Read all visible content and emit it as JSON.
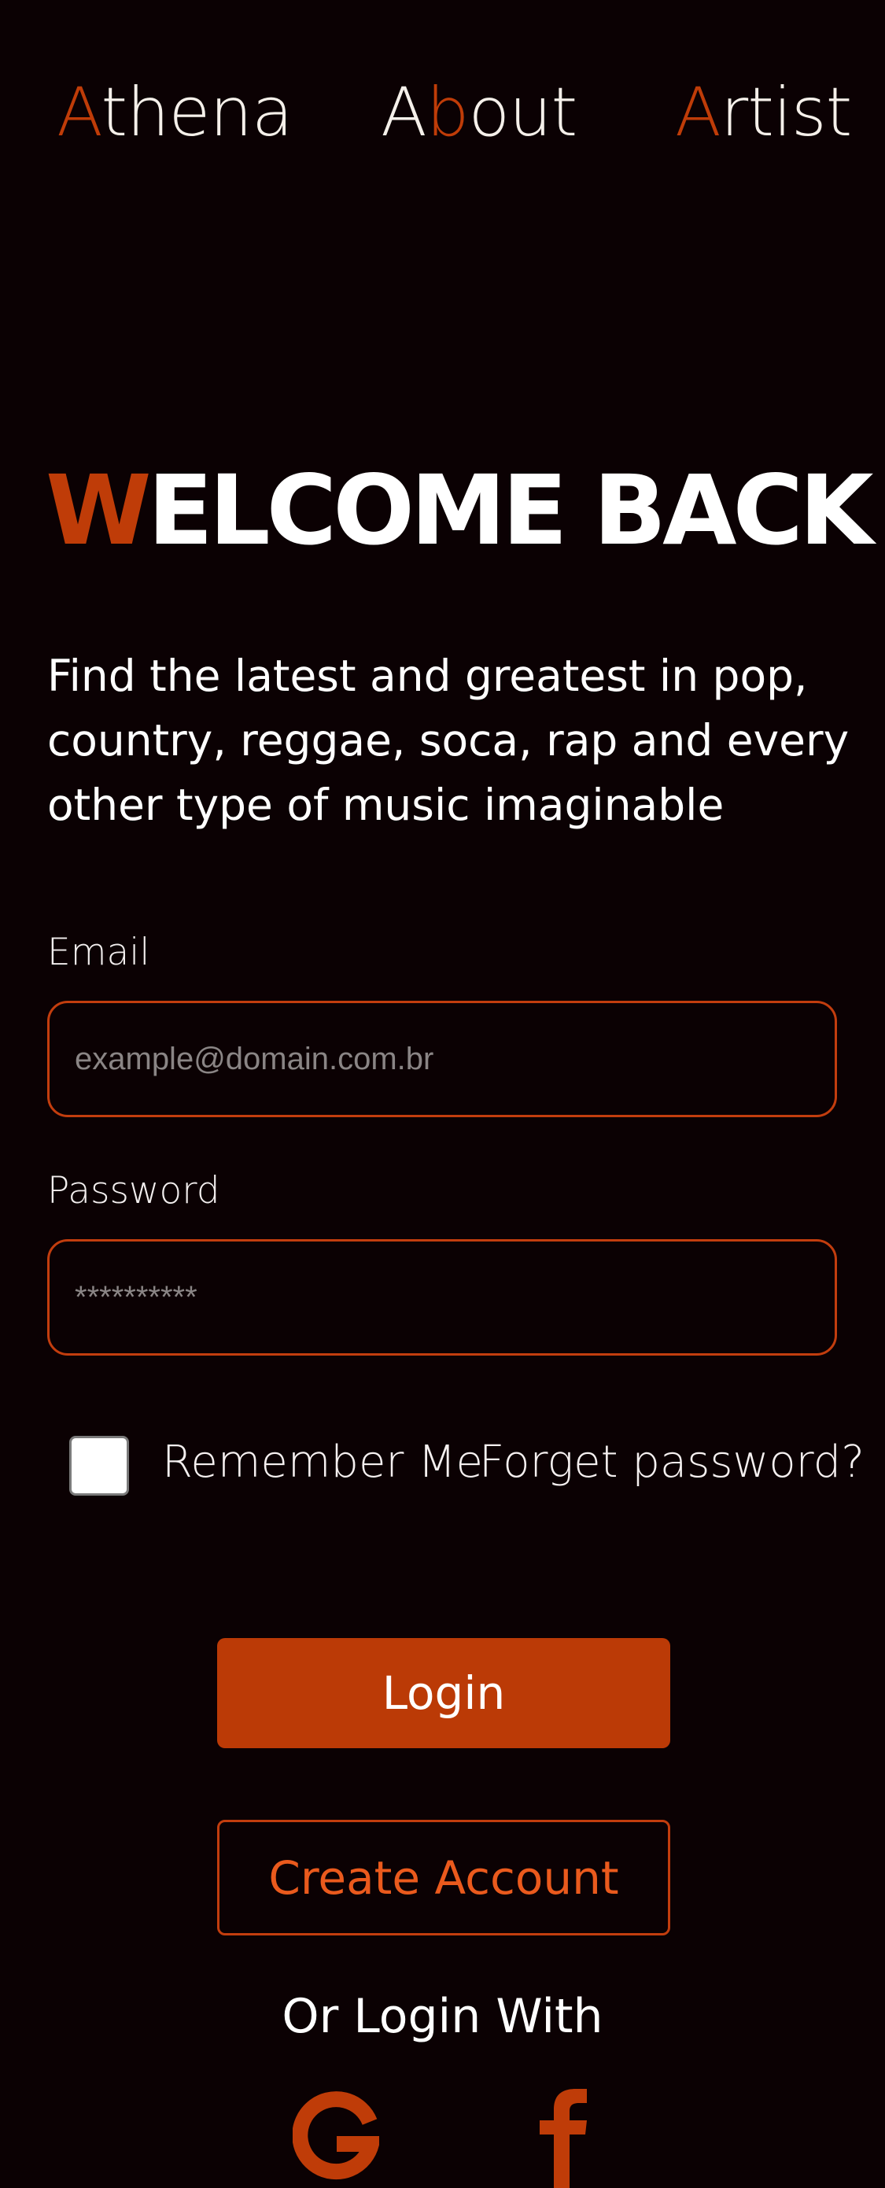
{
  "nav": {
    "items": [
      {
        "first": "A",
        "rest": "thena"
      },
      {
        "first": "A",
        "accent": "b",
        "rest": "out"
      },
      {
        "first": "A",
        "rest": "rtist"
      }
    ]
  },
  "hero": {
    "title_first": "W",
    "title_rest": "ELCOME BACK",
    "tagline": "Find the latest and greatest in pop, country, reggae, soca, rap and every other type of music imaginable"
  },
  "form": {
    "email_label": "Email",
    "email_placeholder": "example@domain.com.br",
    "email_value": "",
    "password_label": "Password",
    "password_placeholder": "**********",
    "password_value": "",
    "remember_label": "Remember Me",
    "remember_checked": false,
    "forget_label": "Forget password?",
    "login_label": "Login",
    "create_account_label": "Create Account",
    "or_login_with": "Or Login With"
  },
  "social": {
    "icons": [
      "google-icon",
      "facebook-icon"
    ]
  },
  "colors": {
    "background": "#0b0103",
    "accent": "#bf3c08",
    "link_accent": "#ea5a1d",
    "text": "#ffffff"
  }
}
